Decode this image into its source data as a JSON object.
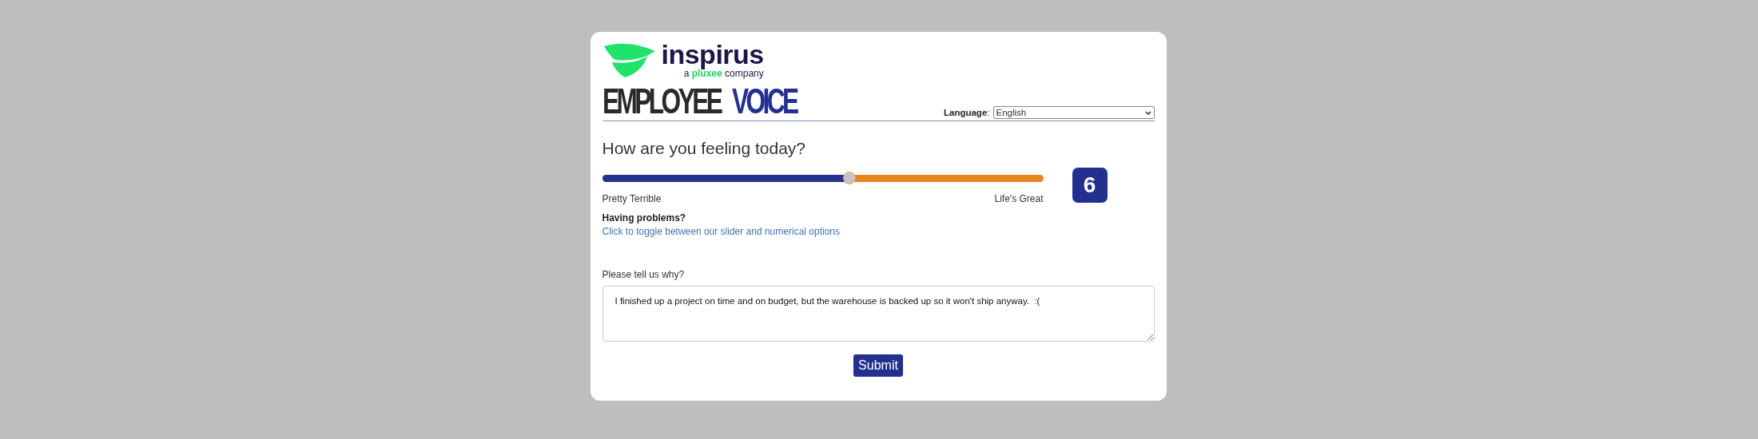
{
  "logo": {
    "name": "inspirus",
    "tagline": "a **pluxee** company"
  },
  "banner": {
    "word_1": "EMPLOYEE",
    "word_2": "VOICE"
  },
  "language": {
    "label": "**Language**:",
    "value": "English"
  },
  "question": "How are you feeling today?",
  "slider": {
    "level": 0.56,
    "min_label": "Pretty Terrible",
    "max_label": "Life's Great",
    "value": "6"
  },
  "help": {
    "title": "Having problems?",
    "link": "Click to toggle between our slider and numerical options"
  },
  "reason": {
    "label": "Please tell us why?",
    "value": "I finished up a project on time and on budget, but the warehouse is backed up so it won't ship anyway.  :("
  },
  "submit": "Submit"
}
